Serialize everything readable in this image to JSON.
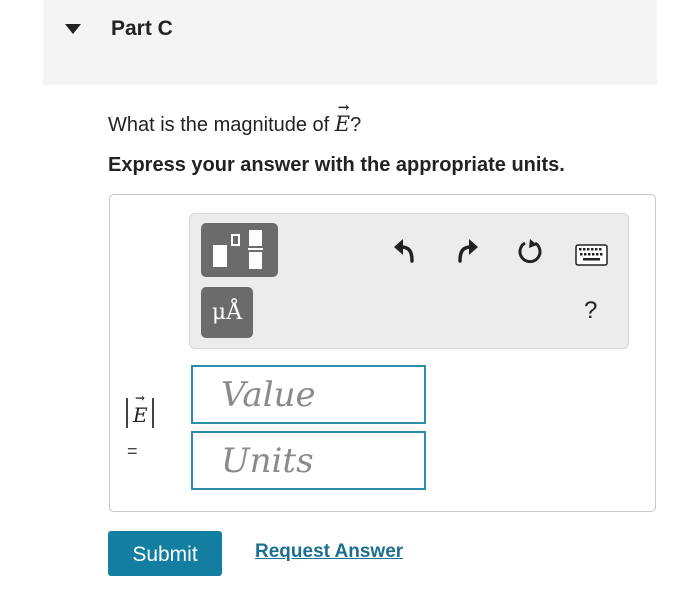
{
  "header": {
    "part_title": "Part C"
  },
  "question": {
    "prefix": "What is the magnitude of ",
    "symbol": "E",
    "suffix": "?",
    "instruction": "Express your answer with the appropriate units."
  },
  "toolbar": {
    "units_button_label": "μÅ",
    "help_label": "?",
    "icons": [
      "templates-icon",
      "units-icon",
      "undo-icon",
      "redo-icon",
      "reset-icon",
      "keyboard-icon",
      "help-icon"
    ]
  },
  "answer": {
    "label_symbol": "E",
    "equals": "=",
    "value_placeholder": "Value",
    "units_placeholder": "Units"
  },
  "actions": {
    "submit_label": "Submit",
    "request_answer_label": "Request Answer"
  },
  "colors": {
    "accent": "#147ea1",
    "link": "#1c6f91",
    "field_border": "#2a8daa",
    "header_bg": "#f4f4f4"
  }
}
